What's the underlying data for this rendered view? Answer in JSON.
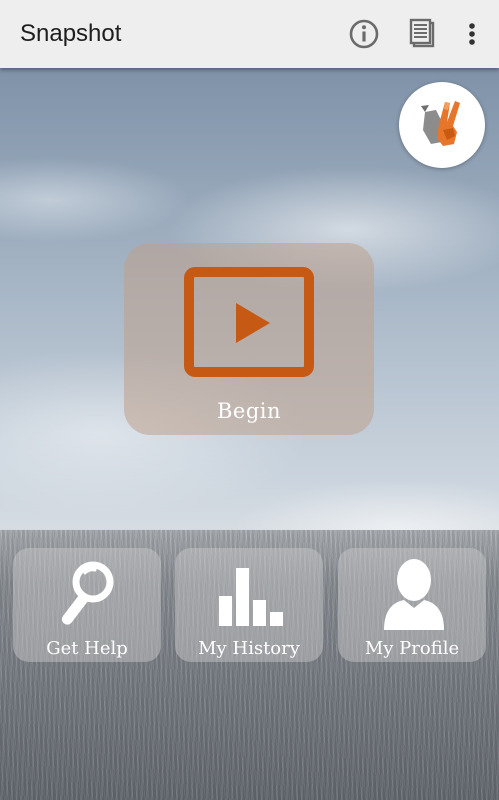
{
  "app": {
    "title": "Snapshot"
  },
  "toolbar": {
    "info_icon": "info-circle-icon",
    "document_icon": "document-list-icon",
    "overflow_icon": "more-vertical-icon"
  },
  "logo": {
    "icon": "hand-peace-sign-logo"
  },
  "begin": {
    "label": "Begin",
    "icon": "play-icon",
    "accent_color": "#c65a14"
  },
  "tiles": [
    {
      "label": "Get Help",
      "icon": "magnifier-icon"
    },
    {
      "label": "My History",
      "icon": "bar-chart-icon"
    },
    {
      "label": "My Profile",
      "icon": "person-icon"
    }
  ]
}
